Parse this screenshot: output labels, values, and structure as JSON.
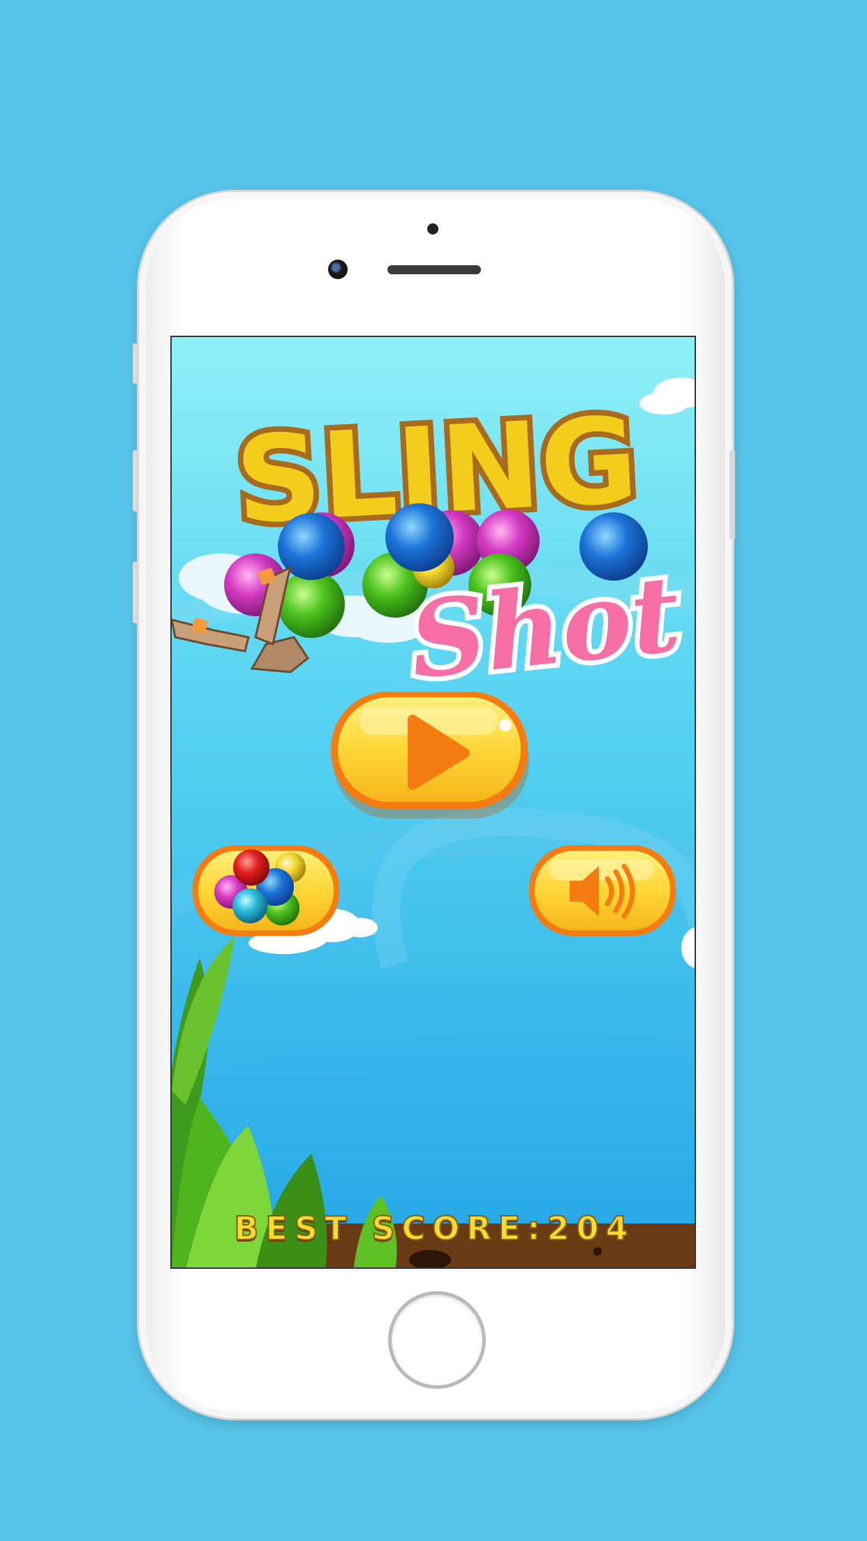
{
  "game": {
    "title_line1": "SLING",
    "title_line2": "Shot",
    "best_score_label": "BEST SCORE:",
    "best_score_value": "204"
  },
  "buttons": {
    "play": "play-icon",
    "bubbles": "bubbles-icon",
    "sound": "speaker-icon"
  },
  "colors": {
    "background": "#57c5ea",
    "title_yellow": "#f3cd1b",
    "title_outline": "#a86a1c",
    "shot_pink": "#f56ea4",
    "button_yellow": "#fcd33a",
    "button_orange": "#f57c10",
    "score_yellow": "#f6dd2c"
  }
}
